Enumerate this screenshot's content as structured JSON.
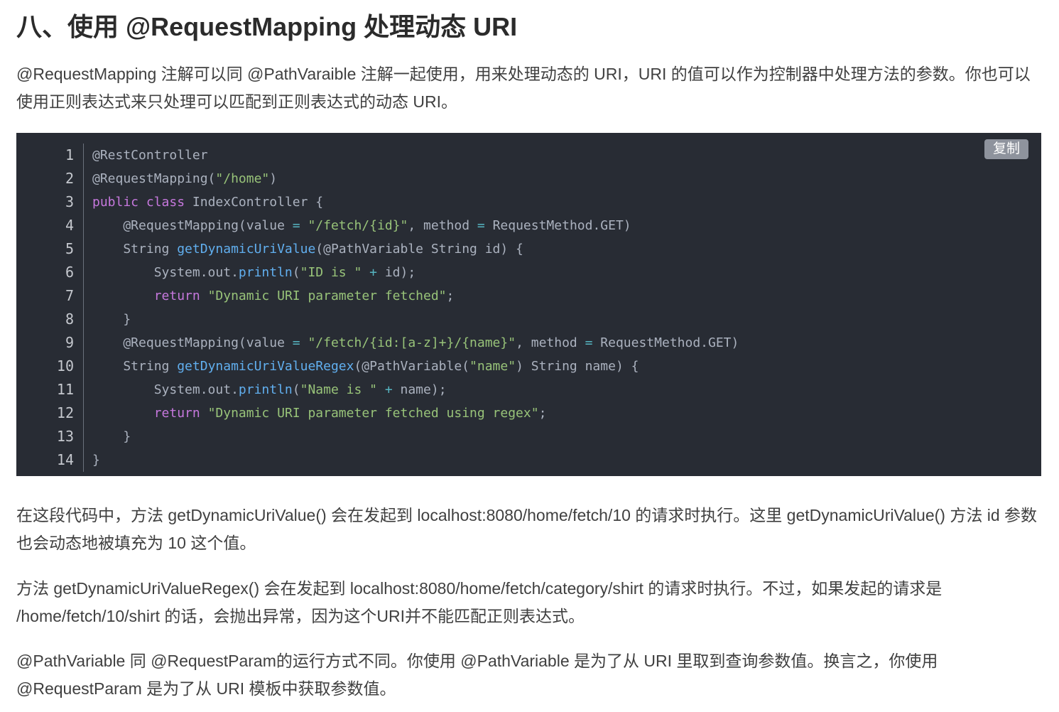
{
  "article": {
    "heading": "八、使用 @RequestMapping 处理动态 URI",
    "intro": "@RequestMapping 注解可以同 @PathVaraible 注解一起使用，用来处理动态的 URI，URI 的值可以作为控制器中处理方法的参数。你也可以使用正则表达式来只处理可以匹配到正则表达式的动态 URI。",
    "paragraph_1": "在这段代码中，方法 getDynamicUriValue() 会在发起到 localhost:8080/home/fetch/10 的请求时执行。这里 getDynamicUriValue() 方法 id 参数也会动态地被填充为 10 这个值。",
    "paragraph_2": "方法 getDynamicUriValueRegex() 会在发起到 localhost:8080/home/fetch/category/shirt 的请求时执行。不过，如果发起的请求是 /home/fetch/10/shirt 的话，会抛出异常，因为这个URI并不能匹配正则表达式。",
    "paragraph_3": "@PathVariable 同 @RequestParam的运行方式不同。你使用 @PathVariable 是为了从 URI 里取到查询参数值。换言之，你使用 @RequestParam 是为了从 URI 模板中获取参数值。"
  },
  "code_block": {
    "copy_label": "复制",
    "language": "java",
    "line_numbers": [
      "1",
      "2",
      "3",
      "4",
      "5",
      "6",
      "7",
      "8",
      "9",
      "10",
      "11",
      "12",
      "13",
      "14"
    ],
    "lines": [
      [
        {
          "t": "ann",
          "v": "@RestController"
        }
      ],
      [
        {
          "t": "ann",
          "v": "@RequestMapping("
        },
        {
          "t": "str",
          "v": "\"/home\""
        },
        {
          "t": "plain",
          "v": ")"
        }
      ],
      [
        {
          "t": "kw",
          "v": "public"
        },
        {
          "t": "plain",
          "v": " "
        },
        {
          "t": "kw",
          "v": "class"
        },
        {
          "t": "plain",
          "v": " IndexController {"
        }
      ],
      [
        {
          "t": "plain",
          "v": "    @RequestMapping(value "
        },
        {
          "t": "op",
          "v": "="
        },
        {
          "t": "plain",
          "v": " "
        },
        {
          "t": "str",
          "v": "\"/fetch/{id}\""
        },
        {
          "t": "plain",
          "v": ", method "
        },
        {
          "t": "op",
          "v": "="
        },
        {
          "t": "plain",
          "v": " RequestMethod.GET)"
        }
      ],
      [
        {
          "t": "plain",
          "v": "    String "
        },
        {
          "t": "fn",
          "v": "getDynamicUriValue"
        },
        {
          "t": "plain",
          "v": "(@PathVariable String id) {"
        }
      ],
      [
        {
          "t": "plain",
          "v": "        System.out."
        },
        {
          "t": "fn",
          "v": "println"
        },
        {
          "t": "plain",
          "v": "("
        },
        {
          "t": "str",
          "v": "\"ID is \""
        },
        {
          "t": "plain",
          "v": " "
        },
        {
          "t": "op",
          "v": "+"
        },
        {
          "t": "plain",
          "v": " id);"
        }
      ],
      [
        {
          "t": "plain",
          "v": "        "
        },
        {
          "t": "kw",
          "v": "return"
        },
        {
          "t": "plain",
          "v": " "
        },
        {
          "t": "str",
          "v": "\"Dynamic URI parameter fetched\""
        },
        {
          "t": "plain",
          "v": ";"
        }
      ],
      [
        {
          "t": "plain",
          "v": "    }"
        }
      ],
      [
        {
          "t": "plain",
          "v": "    @RequestMapping(value "
        },
        {
          "t": "op",
          "v": "="
        },
        {
          "t": "plain",
          "v": " "
        },
        {
          "t": "str",
          "v": "\"/fetch/{id:[a-z]+}/{name}\""
        },
        {
          "t": "plain",
          "v": ", method "
        },
        {
          "t": "op",
          "v": "="
        },
        {
          "t": "plain",
          "v": " RequestMethod.GET)"
        }
      ],
      [
        {
          "t": "plain",
          "v": "    String "
        },
        {
          "t": "fn",
          "v": "getDynamicUriValueRegex"
        },
        {
          "t": "plain",
          "v": "(@PathVariable("
        },
        {
          "t": "str",
          "v": "\"name\""
        },
        {
          "t": "plain",
          "v": ") String name) {"
        }
      ],
      [
        {
          "t": "plain",
          "v": "        System.out."
        },
        {
          "t": "fn",
          "v": "println"
        },
        {
          "t": "plain",
          "v": "("
        },
        {
          "t": "str",
          "v": "\"Name is \""
        },
        {
          "t": "plain",
          "v": " "
        },
        {
          "t": "op",
          "v": "+"
        },
        {
          "t": "plain",
          "v": " name);"
        }
      ],
      [
        {
          "t": "plain",
          "v": "        "
        },
        {
          "t": "kw",
          "v": "return"
        },
        {
          "t": "plain",
          "v": " "
        },
        {
          "t": "str",
          "v": "\"Dynamic URI parameter fetched using regex\""
        },
        {
          "t": "plain",
          "v": ";"
        }
      ],
      [
        {
          "t": "plain",
          "v": "    }"
        }
      ],
      [
        {
          "t": "plain",
          "v": "}"
        }
      ]
    ]
  },
  "colors": {
    "code_background": "#282c34",
    "keyword": "#c678dd",
    "function": "#61afef",
    "string": "#98c379",
    "operator": "#56b6c2",
    "text": "#abb2bf"
  }
}
